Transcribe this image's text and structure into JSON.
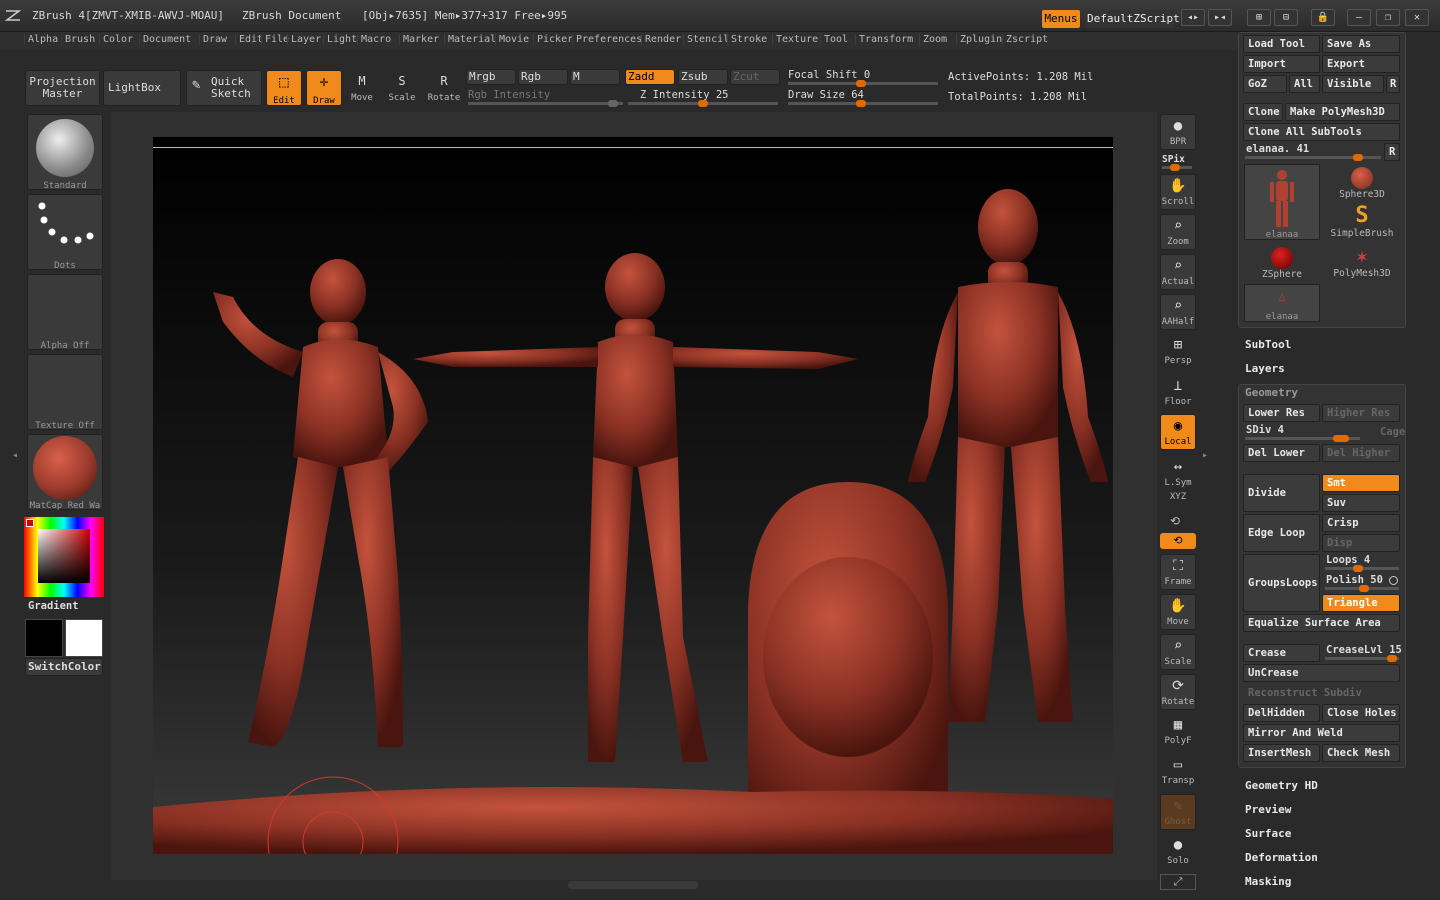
{
  "title": {
    "app": "ZBrush 4[ZMVT-XMIB-AWVJ-MOAU]",
    "doc": "ZBrush Document",
    "obj": "[Obj▸7635] Mem▸377+317 Free▸995",
    "menus": "Menus",
    "script": "DefaultZScript"
  },
  "menubar": [
    "Alpha",
    "Brush",
    "Color",
    "Document",
    "Draw",
    "Edit",
    "File",
    "Layer",
    "Light",
    "Macro",
    "Marker",
    "Material",
    "Movie",
    "Picker",
    "Preferences",
    "Render",
    "Stencil",
    "Stroke",
    "Texture",
    "Tool",
    "Transform",
    "Zoom",
    "Zplugin",
    "Zscript"
  ],
  "toolbar": {
    "projection_master": "Projection Master",
    "lightbox": "LightBox",
    "quick_sketch": "Quick Sketch",
    "edit": "Edit",
    "draw": "Draw",
    "move": "Move",
    "scale": "Scale",
    "rotate": "Rotate",
    "mrgb": "Mrgb",
    "rgb": "Rgb",
    "m": "M",
    "zadd": "Zadd",
    "zsub": "Zsub",
    "zcut": "Zcut",
    "rgb_intensity": "Rgb Intensity",
    "z_intensity": "Z Intensity 25",
    "focal_shift": "Focal Shift 0",
    "draw_size": "Draw Size 64",
    "active_points": "ActivePoints: 1.208 Mil",
    "total_points": "TotalPoints: 1.208 Mil"
  },
  "leftshelf": {
    "brush": "Standard",
    "stroke": "Dots",
    "alpha": "Alpha Off",
    "texture": "Texture Off",
    "material": "MatCap Red Wa",
    "gradient": "Gradient",
    "switchcolor": "SwitchColor"
  },
  "rightshelf": {
    "bpr": "BPR",
    "spix": "SPix",
    "scroll": "Scroll",
    "zoom": "Zoom",
    "actual": "Actual",
    "aahalf": "AAHalf",
    "persp": "Persp",
    "floor": "Floor",
    "local": "Local",
    "lsym": "L.Sym",
    "xyz": "XYZ",
    "frame": "Frame",
    "move": "Move",
    "scale": "Scale",
    "rotate": "Rotate",
    "polyf": "PolyF",
    "transp": "Transp",
    "ghost": "Ghost",
    "solo": "Solo"
  },
  "tool": {
    "load_tool": "Load Tool",
    "save_as": "Save As",
    "import": "Import",
    "export": "Export",
    "goz": "GoZ",
    "all": "All",
    "visible": "Visible",
    "r": "R",
    "clone": "Clone",
    "make_polymesh": "Make PolyMesh3D",
    "clone_all": "Clone All SubTools",
    "current": "elanaa. 41",
    "tools": [
      "elanaa",
      "Sphere3D",
      "SimpleBrush",
      "ZSphere",
      "PolyMesh3D",
      "elanaa"
    ]
  },
  "panel": {
    "subtool": "SubTool",
    "layers": "Layers",
    "geometry": "Geometry",
    "lower_res": "Lower Res",
    "higher_res": "Higher Res",
    "sdiv": "SDiv 4",
    "cage": "Cage",
    "del_lower": "Del Lower",
    "del_higher": "Del Higher",
    "divide": "Divide",
    "smt": "Smt",
    "suv": "Suv",
    "edge_loop": "Edge Loop",
    "crisp": "Crisp",
    "disp": "Disp",
    "groupsloops": "GroupsLoops",
    "loops": "Loops 4",
    "polish": "Polish 50",
    "triangle": "Triangle",
    "equalize": "Equalize Surface Area",
    "crease": "Crease",
    "creaselvl": "CreaseLvl 15",
    "uncrease": "UnCrease",
    "reconstruct": "Reconstruct Subdiv",
    "delhidden": "DelHidden",
    "close_holes": "Close Holes",
    "mirror_weld": "Mirror And Weld",
    "insertmesh": "InsertMesh",
    "check_mesh": "Check Mesh",
    "geometry_hd": "Geometry HD",
    "preview": "Preview",
    "surface": "Surface",
    "deformation": "Deformation",
    "masking": "Masking"
  },
  "colors": {
    "accent": "#f08a1a",
    "clay": "#9a3a2c"
  }
}
